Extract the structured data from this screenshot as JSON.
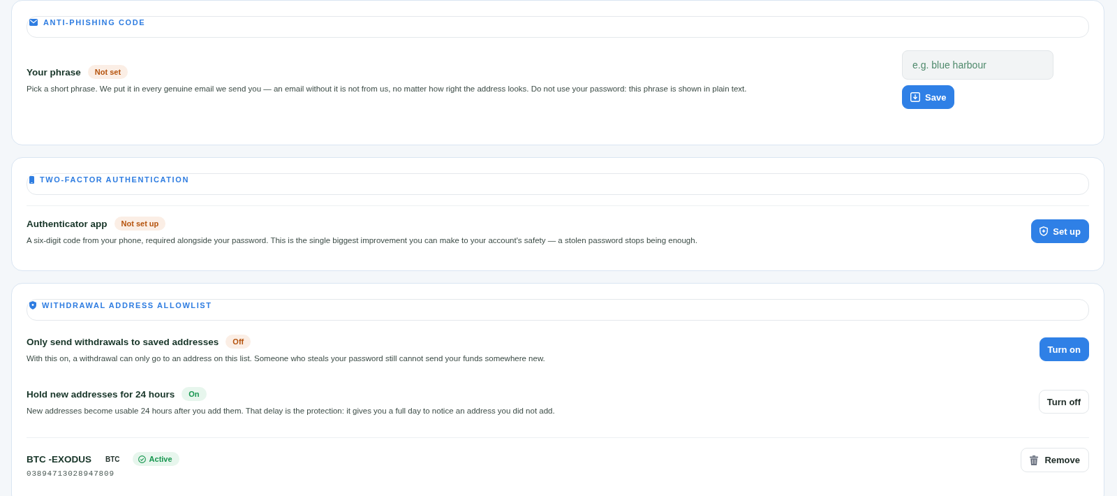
{
  "sections": [
    {
      "kind": "phishing",
      "title": "ANTI-PHISHING CODE",
      "rows": [
        {
          "kind": "phrase",
          "title": "Your phrase",
          "badge": "Not set",
          "on": false,
          "description": "Pick a short phrase. We put it in every genuine email we send you — an email without it is not from us, no matter how right the address looks. Do not use your password: this phrase is shown in plain text.",
          "placeholder": "e.g. blue harbour",
          "button": "Save"
        }
      ]
    },
    {
      "kind": "twofactor",
      "title": "TWO-FACTOR AUTHENTICATION",
      "rows": [
        {
          "kind": "factor",
          "title": "Authenticator app",
          "badge": "Not set up",
          "on": false,
          "description": "A six-digit code from your phone, required alongside your password. This is the single biggest improvement you can make to your account's safety — a stolen password stops being enough.",
          "button": "Set up"
        }
      ]
    },
    {
      "kind": "allowlist",
      "title": "WITHDRAWAL ADDRESS ALLOWLIST",
      "rows": [
        {
          "kind": "toggle",
          "title": "Only send withdrawals to saved addresses",
          "badge": "Off",
          "on": false,
          "description": "With this on, a withdrawal can only go to an address on this list. Someone who steals your password still cannot send your funds somewhere new.",
          "button": "Turn on"
        },
        {
          "kind": "toggle",
          "title": "Hold new addresses for 24 hours",
          "badge": "On",
          "on": true,
          "description": "New addresses become usable 24 hours after you add them. That delay is the protection: it gives you a full day to notice an address you did not add.",
          "button": "Turn off"
        },
        {
          "kind": "address",
          "title": "BTC -EXODUS",
          "asset": "BTC",
          "badge": "Active",
          "on": true,
          "address": "03894713028947809",
          "button": "Remove"
        }
      ]
    }
  ]
}
